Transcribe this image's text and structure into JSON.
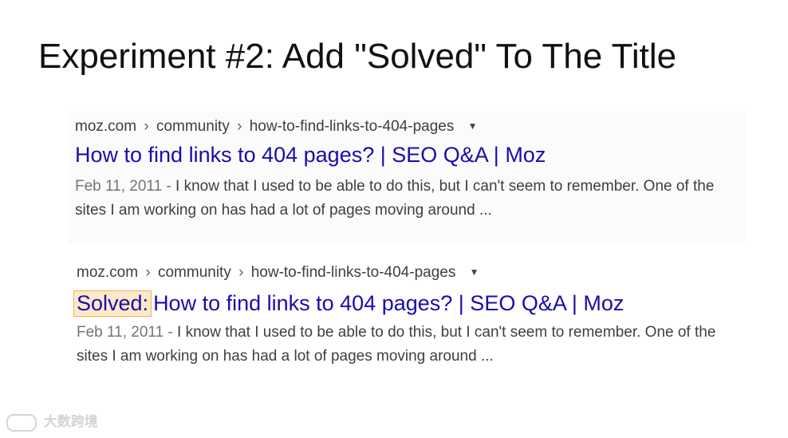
{
  "slide": {
    "title": "Experiment #2: Add \"Solved\" To The Title"
  },
  "results": [
    {
      "breadcrumb": {
        "domain": "moz.com",
        "path1": "community",
        "path2": "how-to-find-links-to-404-pages",
        "separator": "›",
        "dropdown_icon": "▼"
      },
      "prefix": "",
      "title": "How to find links to 404 pages? | SEO Q&A | Moz",
      "date": "Feb 11, 2011 -",
      "snippet": " I know that I used to be able to do this, but I can't seem to remember. One of the sites I am working on has had a lot of pages moving around ..."
    },
    {
      "breadcrumb": {
        "domain": "moz.com",
        "path1": "community",
        "path2": "how-to-find-links-to-404-pages",
        "separator": "›",
        "dropdown_icon": "▼"
      },
      "prefix": "Solved:",
      "title": "How to find links to 404 pages? | SEO Q&A | Moz",
      "date": "Feb 11, 2011 -",
      "snippet": " I know that I used to be able to do this, but I can't seem to remember. One of the sites I am working on has had a lot of pages moving around ..."
    }
  ],
  "watermark": {
    "text": "大数跨境"
  },
  "colors": {
    "link": "#1a0dab",
    "highlight_bg": "#fde9c8",
    "highlight_border": "#f0b257",
    "snippet_text": "#3c4043",
    "date_text": "#70757a"
  }
}
